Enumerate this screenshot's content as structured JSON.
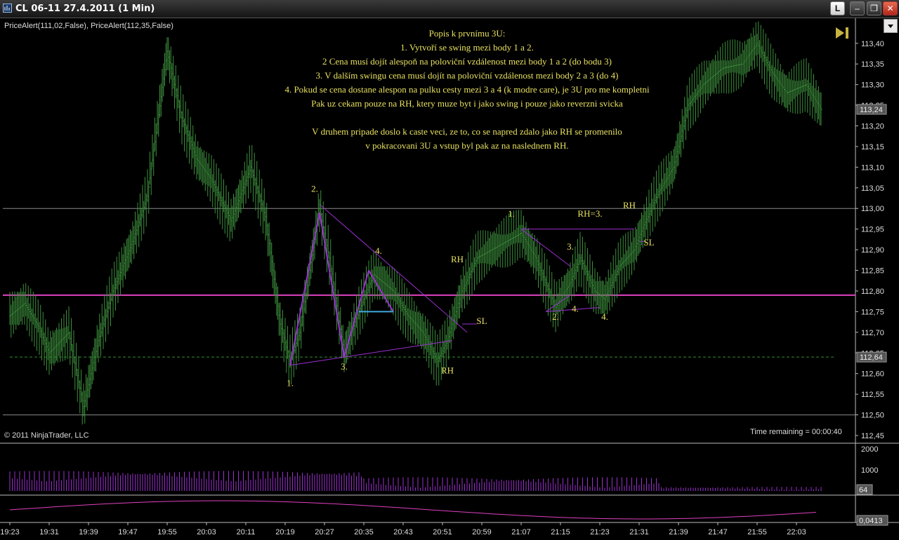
{
  "window": {
    "title": "CL 06-11  27.4.2011 (1 Min)",
    "buttons": [
      "L",
      "–",
      "❐",
      "✕"
    ]
  },
  "indicator_label": "PriceAlert(111,02,False), PriceAlert(112,35,False)",
  "copyright": "© 2011 NinjaTrader, LLC",
  "time_remaining": "Time remaining = 00:00:40",
  "notes": [
    "Popis k prvnímu 3U:",
    "1. Vytvoří se swing mezi body 1 a 2.",
    "2 Cena musí dojít alespoň na poloviční vzdálenost mezi body 1 a 2 (do bodu 3)",
    "3. V dalším swingu cena musí dojít na poloviční vzdálenost mezi body 2 a 3 (do 4)",
    "4. Pokud se cena dostane alespon na pulku cesty mezi 3 a 4 (k modre care), je 3U pro me kompletni",
    "Pak uz cekam pouze na RH, ktery muze byt i jako swing i pouze jako reverzni svicka",
    "",
    "V druhem pripade doslo k caste veci, ze to, co se napred zdalo jako RH se promenilo",
    "v pokracovani 3U a vstup byl pak az na naslednem RH."
  ],
  "colors": {
    "background": "#000000",
    "bar": "#3d8f3d",
    "annotation_line": "#9b30d0",
    "level_line": "#e040c0",
    "cyan": "#40a8e0",
    "annotation_text": "#e8e060",
    "dash_line": "#2f8f2f",
    "volume": "#9b30d0"
  },
  "chart_data": {
    "type": "bar",
    "price_axis": {
      "min": 112.45,
      "max": 113.42,
      "ticks": [
        "113,40",
        "113,35",
        "113,30",
        "113,25",
        "113,20",
        "113,15",
        "113,10",
        "113,05",
        "113,00",
        "112,95",
        "112,90",
        "112,85",
        "112,80",
        "112,75",
        "112,70",
        "112,65",
        "112,60",
        "112,55",
        "112,50",
        "112,45"
      ],
      "last_price_label": "113,24",
      "last_price": 113.24,
      "alert_label": "112,64",
      "alert_price": 112.64
    },
    "time_axis": {
      "labels": [
        "19:23",
        "19:31",
        "19:39",
        "19:47",
        "19:55",
        "20:03",
        "20:11",
        "20:19",
        "20:27",
        "20:35",
        "20:43",
        "20:51",
        "20:59",
        "21:07",
        "21:15",
        "21:23",
        "21:31",
        "21:39",
        "21:47",
        "21:55",
        "22:03"
      ]
    },
    "horizontal_lines": [
      {
        "price": 113.0,
        "style": "gray"
      },
      {
        "price": 112.5,
        "style": "gray"
      },
      {
        "price": 112.79,
        "style": "magenta"
      },
      {
        "price": 112.64,
        "style": "green-dashed"
      }
    ],
    "annotations": [
      {
        "text": "1.",
        "time": "20:20",
        "price": 112.57
      },
      {
        "text": "2.",
        "time": "20:25",
        "price": 113.04
      },
      {
        "text": "3.",
        "time": "20:31",
        "price": 112.61
      },
      {
        "text": "4.",
        "time": "20:38",
        "price": 112.89
      },
      {
        "text": "RH",
        "time": "20:52",
        "price": 112.6
      },
      {
        "text": "RH",
        "time": "20:54",
        "price": 112.87
      },
      {
        "text": "SL",
        "time": "20:59",
        "price": 112.72
      },
      {
        "text": "1.",
        "time": "21:05",
        "price": 112.98
      },
      {
        "text": "3.",
        "time": "21:17",
        "price": 112.9
      },
      {
        "text": "RH=3.",
        "time": "21:21",
        "price": 112.98
      },
      {
        "text": "2.",
        "time": "21:14",
        "price": 112.73
      },
      {
        "text": "4.",
        "time": "21:18",
        "price": 112.75
      },
      {
        "text": "4.",
        "time": "21:24",
        "price": 112.73
      },
      {
        "text": "RH",
        "time": "21:29",
        "price": 113.0
      },
      {
        "text": "SL",
        "time": "21:33",
        "price": 112.91
      }
    ],
    "volume_axis": {
      "ticks": [
        "2000",
        "1000"
      ],
      "last_label": "64",
      "last": 64,
      "max": 2000
    },
    "indicator_axis": {
      "last_label": "0,0413",
      "last": 0.0413
    }
  }
}
